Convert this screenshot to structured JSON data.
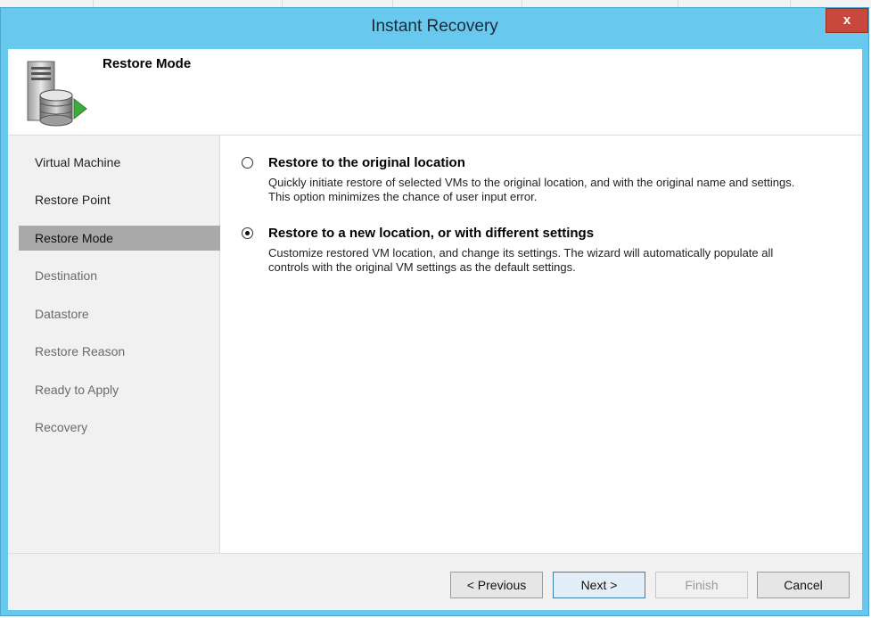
{
  "window": {
    "title": "Instant Recovery",
    "close_label": "x"
  },
  "header": {
    "title": "Restore Mode",
    "icon": "server-database-restore-icon"
  },
  "sidebar": {
    "items": [
      {
        "label": "Virtual Machine",
        "state": "done"
      },
      {
        "label": "Restore Point",
        "state": "done"
      },
      {
        "label": "Restore Mode",
        "state": "active"
      },
      {
        "label": "Destination",
        "state": "disabled"
      },
      {
        "label": "Datastore",
        "state": "disabled"
      },
      {
        "label": "Restore Reason",
        "state": "disabled"
      },
      {
        "label": "Ready to Apply",
        "state": "disabled"
      },
      {
        "label": "Recovery",
        "state": "disabled"
      }
    ]
  },
  "options": [
    {
      "title": "Restore to the original location",
      "description": "Quickly initiate restore of selected VMs to the original location, and with the original name and settings. This option minimizes the chance of user input error.",
      "selected": false
    },
    {
      "title": "Restore to a new location, or with different settings",
      "description": "Customize restored VM location, and change its settings. The wizard will automatically populate all controls with the original VM settings as the default settings.",
      "selected": true
    }
  ],
  "footer": {
    "previous_label": "< Previous",
    "next_label": "Next >",
    "finish_label": "Finish",
    "cancel_label": "Cancel"
  },
  "colors": {
    "titlebar": "#68c8ee",
    "close": "#c9483c",
    "active_nav": "#a9a9a9",
    "panel": "#f1f1f1"
  }
}
